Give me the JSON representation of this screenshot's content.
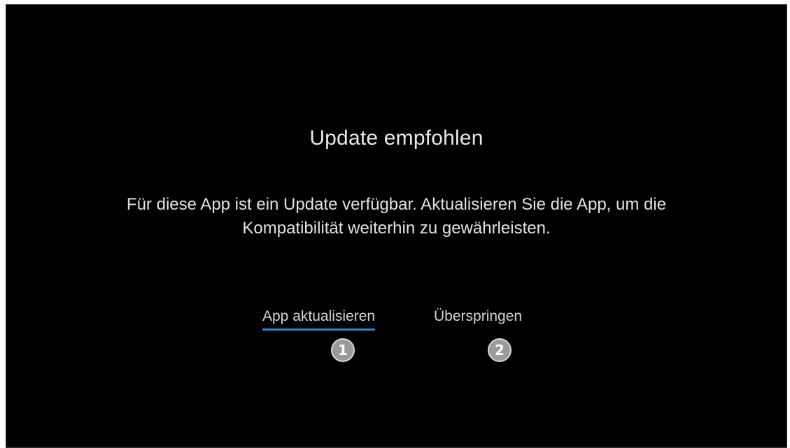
{
  "dialog": {
    "title": "Update empfohlen",
    "message_line1": "Für diese App ist ein Update verfügbar. Aktualisieren Sie die App, um die",
    "message_line2": "Kompatibilität weiterhin zu gewährleisten.",
    "buttons": [
      {
        "label": "App aktualisieren",
        "focused": true
      },
      {
        "label": "Überspringen",
        "focused": false
      }
    ]
  },
  "callouts": [
    "1",
    "2"
  ],
  "colors": {
    "background": "#000000",
    "text": "#e2e2e2",
    "focus_underline": "#2e86e0",
    "callout_fill": "#9a9a9a"
  }
}
